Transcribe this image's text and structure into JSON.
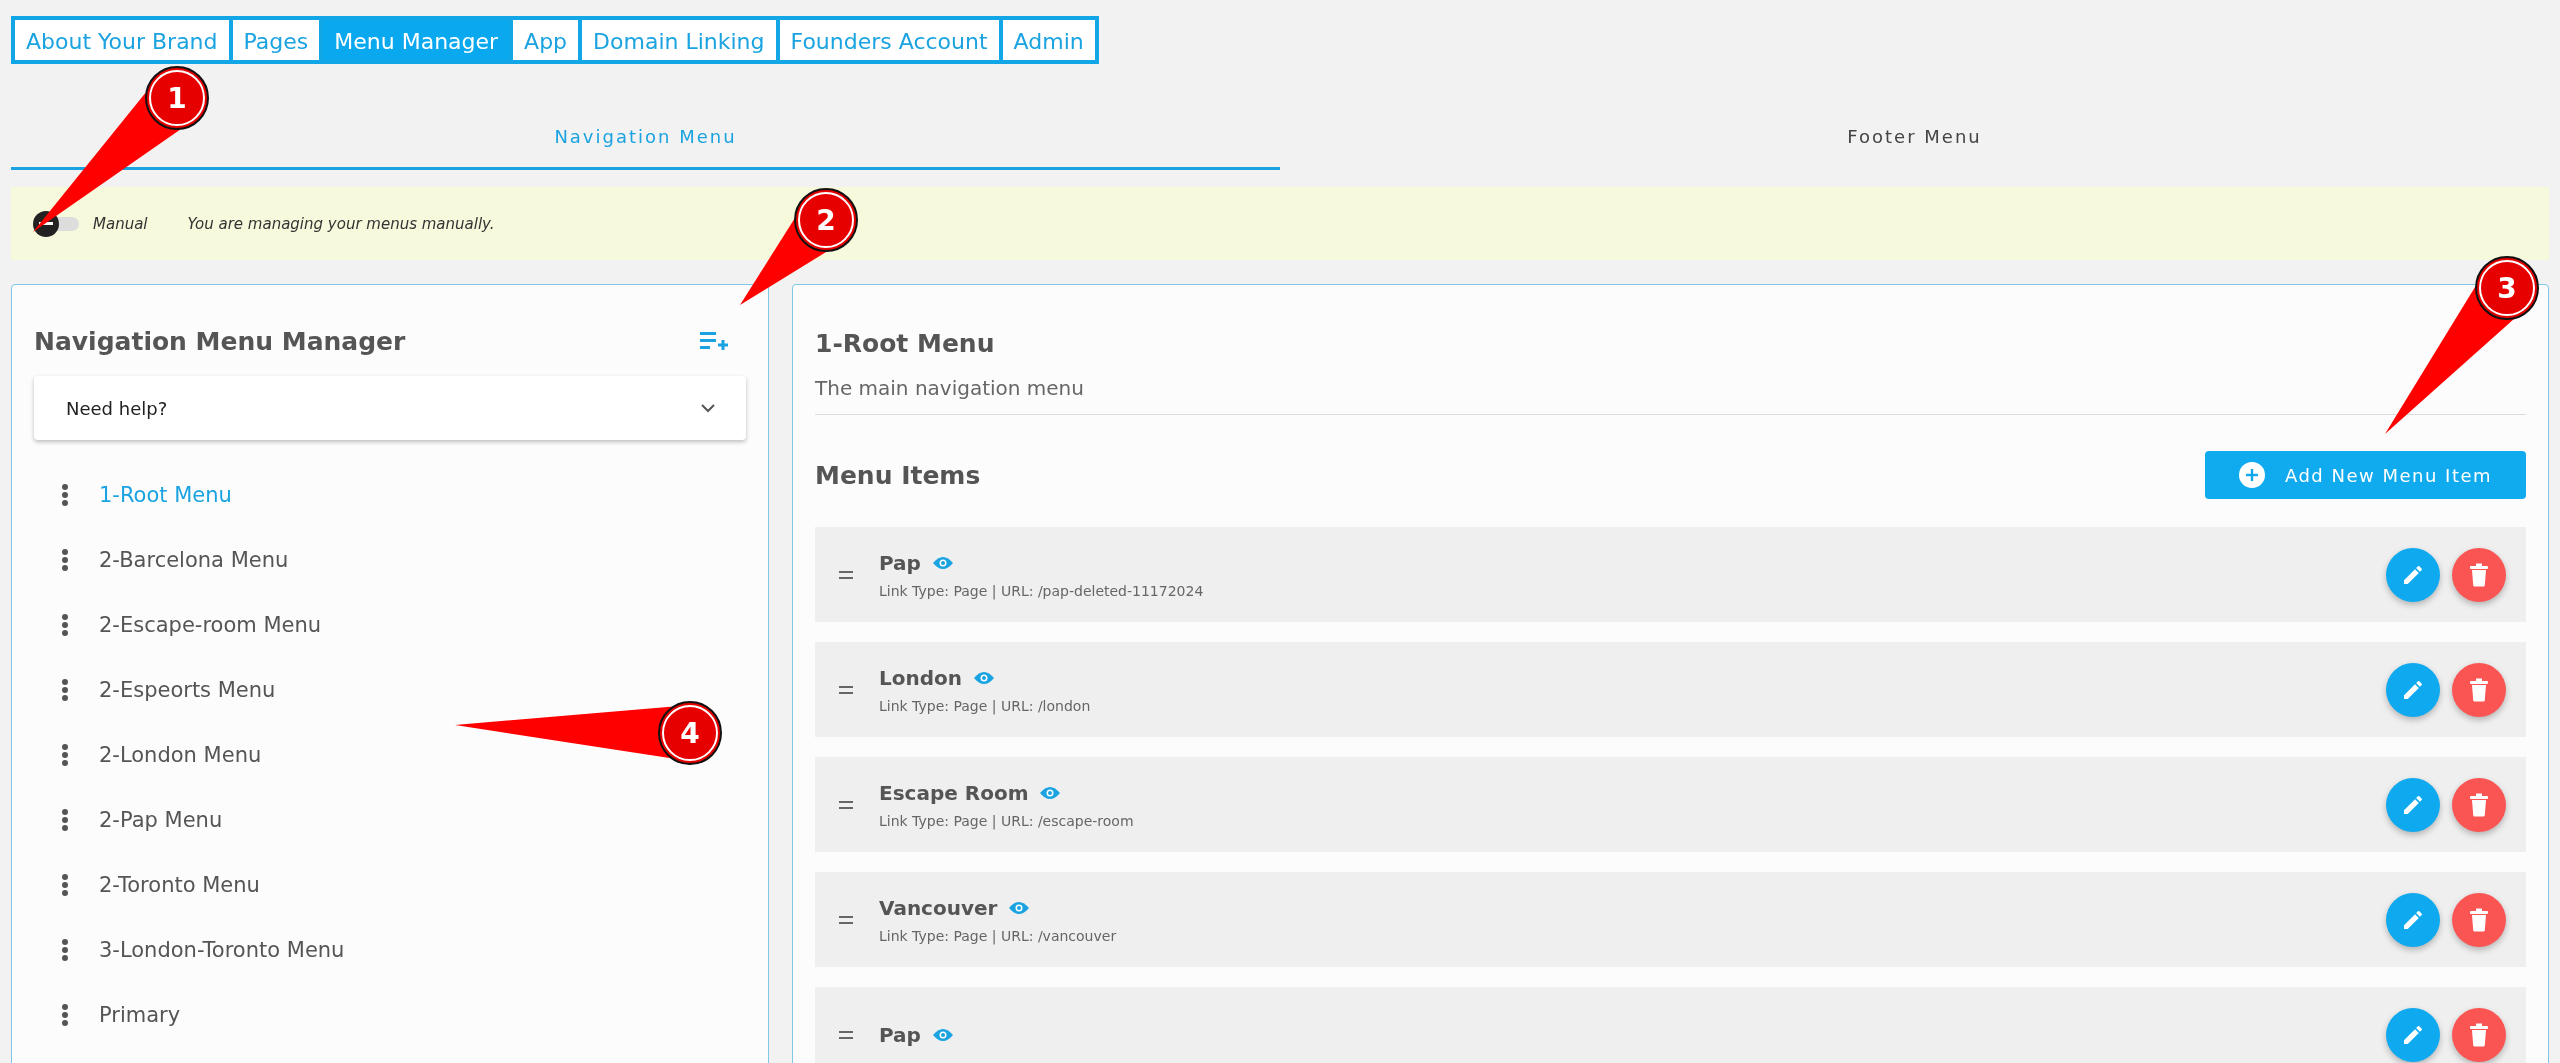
{
  "top_tabs": [
    {
      "label": "About Your Brand",
      "selected": false
    },
    {
      "label": "Pages",
      "selected": false
    },
    {
      "label": "Menu Manager",
      "selected": true
    },
    {
      "label": "App",
      "selected": false
    },
    {
      "label": "Domain Linking",
      "selected": false
    },
    {
      "label": "Founders Account",
      "selected": false
    },
    {
      "label": "Admin",
      "selected": false
    }
  ],
  "menu_tabs": [
    {
      "label": "Navigation Menu",
      "selected": true
    },
    {
      "label": "Footer Menu",
      "selected": false
    }
  ],
  "mode_banner": {
    "toggle_on": false,
    "label": "Manual",
    "message": "You are managing your menus manually."
  },
  "manager": {
    "title": "Navigation Menu Manager",
    "help": "Need help?",
    "menus": [
      {
        "label": "1-Root Menu",
        "selected": true
      },
      {
        "label": "2-Barcelona Menu",
        "selected": false
      },
      {
        "label": "2-Escape-room Menu",
        "selected": false
      },
      {
        "label": "2-Espeorts Menu",
        "selected": false
      },
      {
        "label": "2-London Menu",
        "selected": false
      },
      {
        "label": "2-Pap Menu",
        "selected": false
      },
      {
        "label": "2-Toronto Menu",
        "selected": false
      },
      {
        "label": "3-London-Toronto Menu",
        "selected": false
      },
      {
        "label": "Primary",
        "selected": false
      }
    ]
  },
  "detail": {
    "title": "1-Root Menu",
    "description": "The main navigation menu",
    "items_heading": "Menu Items",
    "add_button": "Add New Menu Item",
    "items": [
      {
        "title": "Pap",
        "link": "Link Type: Page | URL: /pap-deleted-11172024"
      },
      {
        "title": "London",
        "link": "Link Type: Page | URL: /london"
      },
      {
        "title": "Escape Room",
        "link": "Link Type: Page | URL: /escape-room"
      },
      {
        "title": "Vancouver",
        "link": "Link Type: Page | URL: /vancouver"
      },
      {
        "title": "Pap"
      }
    ]
  },
  "callouts": [
    "1",
    "2",
    "3",
    "4"
  ]
}
